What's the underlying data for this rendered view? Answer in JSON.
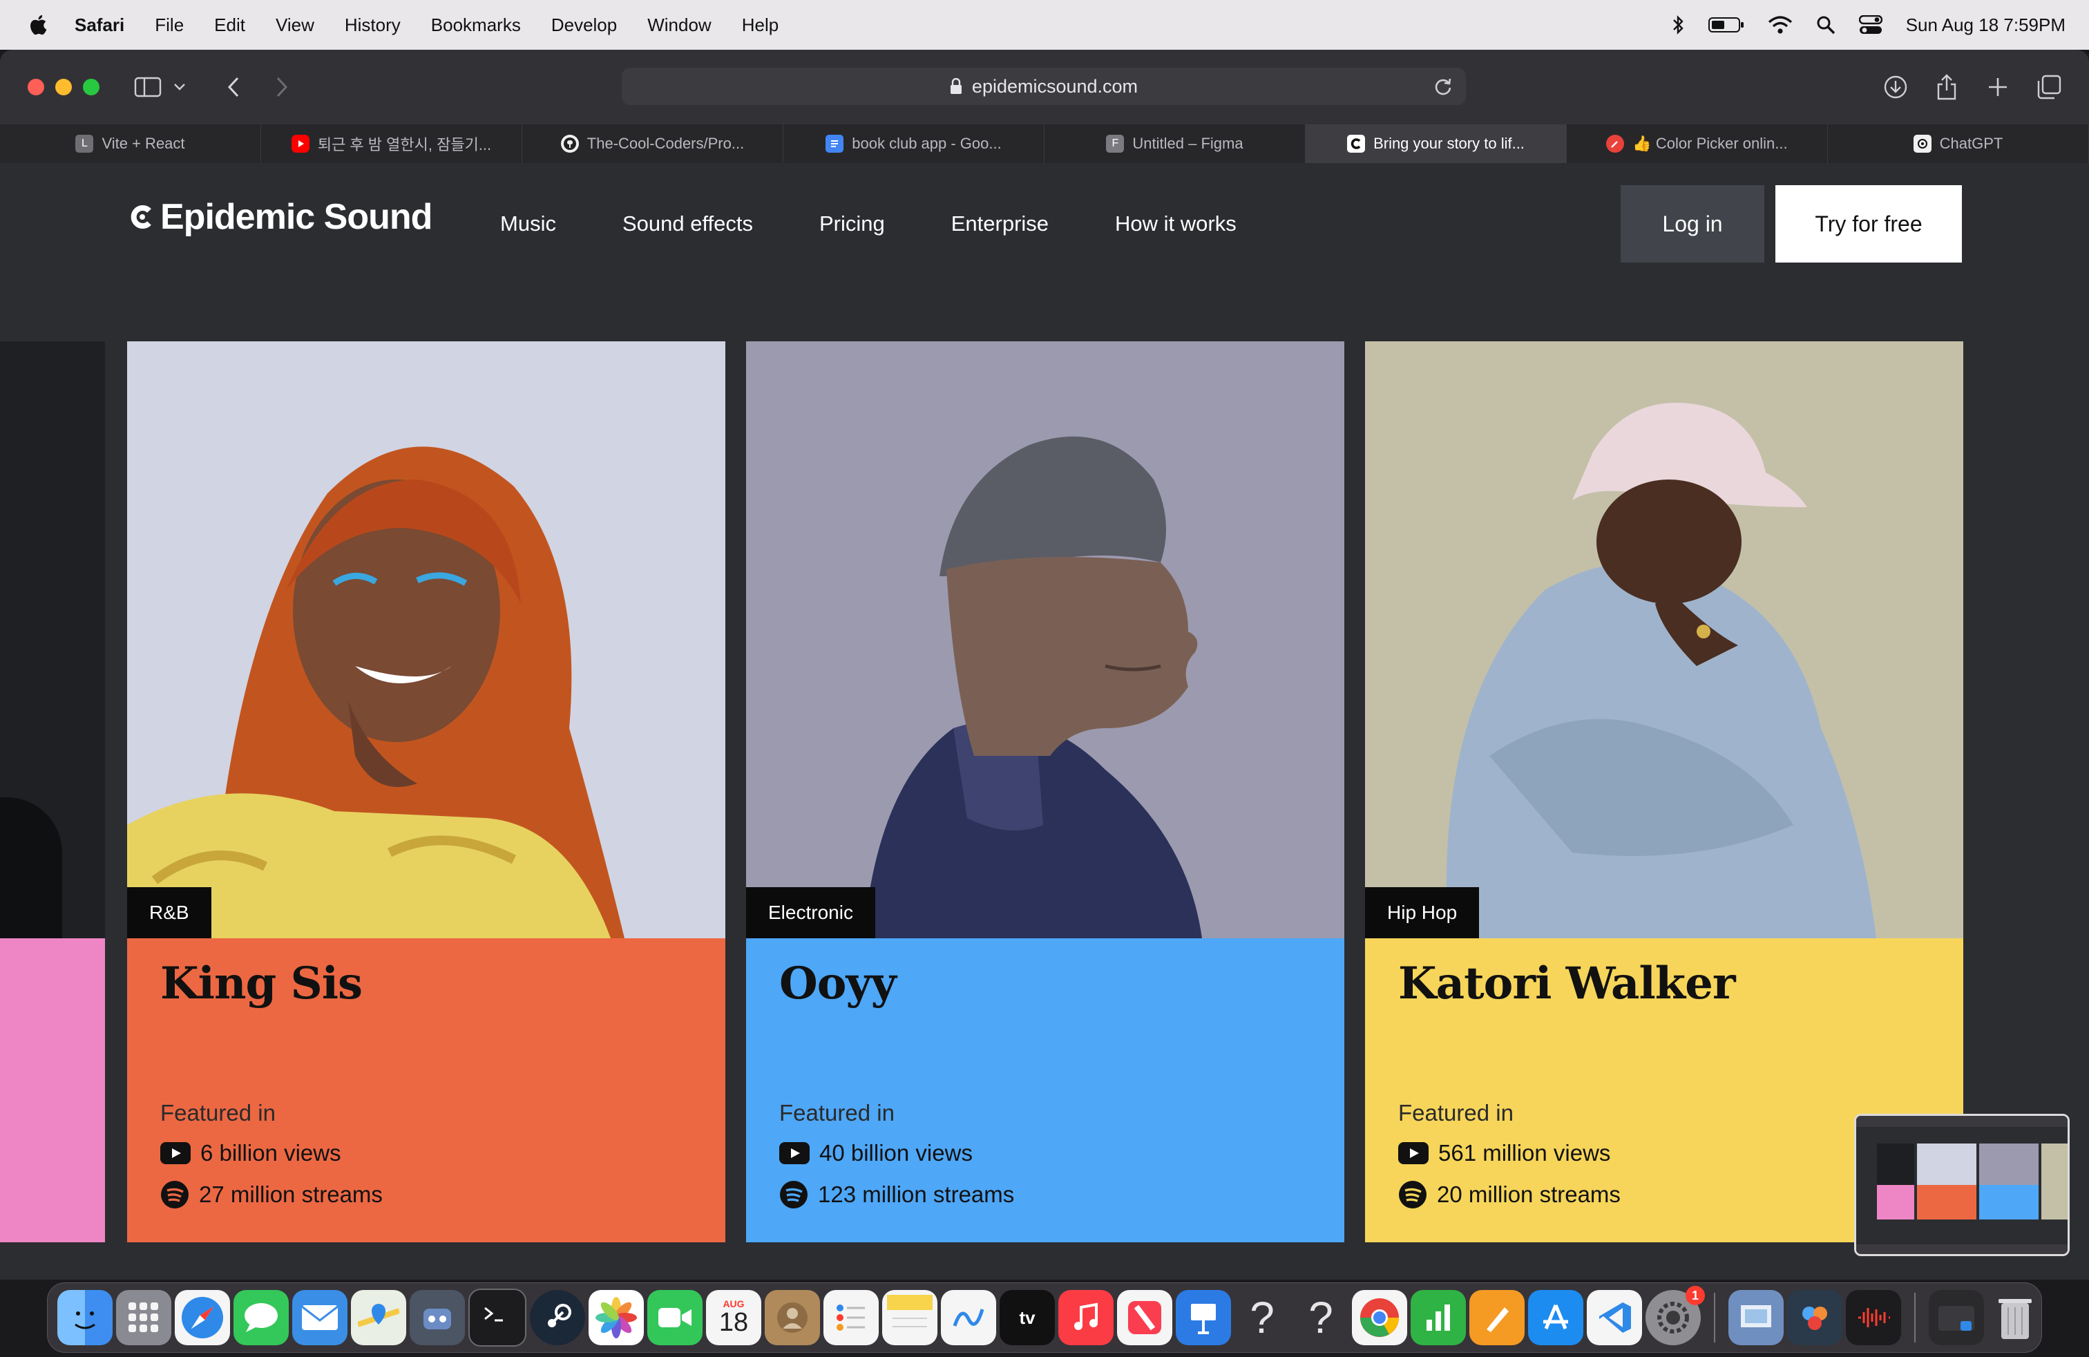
{
  "menubar": {
    "app_name": "Safari",
    "items": [
      "File",
      "Edit",
      "View",
      "History",
      "Bookmarks",
      "Develop",
      "Window",
      "Help"
    ],
    "clock": "Sun Aug 18  7:59PM"
  },
  "browser": {
    "url": "epidemicsound.com",
    "tabs": [
      {
        "label": "Vite + React",
        "favicon": "L",
        "color": "#6e6e73"
      },
      {
        "label": "퇴근 후 밤 열한시, 잠들기...",
        "favicon": "youtube-icon",
        "color": "#ff0000"
      },
      {
        "label": "The-Cool-Coders/Pro...",
        "favicon": "github-icon",
        "color": "#2b2b2b"
      },
      {
        "label": "book club app - Goo...",
        "favicon": "docs-icon",
        "color": "#4285f4"
      },
      {
        "label": "Untitled – Figma",
        "favicon": "F",
        "color": "#7a7a80"
      },
      {
        "label": "Bring your story to lif...",
        "favicon": "epidemic-icon",
        "color": "#000000"
      },
      {
        "label": "👍 Color Picker onlin...",
        "favicon": "picker-icon",
        "color": "#e8423a"
      },
      {
        "label": "ChatGPT",
        "favicon": "chatgpt-icon",
        "color": "#f0f0f0"
      }
    ],
    "active_tab_index": 5
  },
  "site": {
    "logo_text": "Epidemic Sound",
    "nav": [
      "Music",
      "Sound effects",
      "Pricing",
      "Enterprise",
      "How it works"
    ],
    "login_label": "Log in",
    "try_label": "Try for free",
    "partial_card_color": "#ee86c5",
    "artists": [
      {
        "genre": "R&B",
        "name": "King Sis",
        "featured_label": "Featured in",
        "views": "6 billion views",
        "streams": "27 million streams",
        "color": "#ec6843",
        "photo_bg": "#d1d4e2"
      },
      {
        "genre": "Electronic",
        "name": "Ooyy",
        "featured_label": "Featured in",
        "views": "40 billion views",
        "streams": "123 million streams",
        "color": "#4ea7f7",
        "photo_bg": "#9c9aaf"
      },
      {
        "genre": "Hip Hop",
        "name": "Katori Walker",
        "featured_label": "Featured in",
        "views": "561 million views",
        "streams": "20 million streams",
        "color": "#f6d55a",
        "photo_bg": "#c4c0a8"
      }
    ]
  },
  "dock": {
    "apps": [
      {
        "name": "finder-icon",
        "color": "#3d8ef0"
      },
      {
        "name": "launchpad-icon",
        "color": "#8a8a93"
      },
      {
        "name": "safari-icon",
        "color": "#2f89e8"
      },
      {
        "name": "messages-icon",
        "color": "#34c759"
      },
      {
        "name": "mail-icon",
        "color": "#3a8ee6"
      },
      {
        "name": "maps-icon",
        "color": "#5fb85a"
      },
      {
        "name": "discord-bot-icon",
        "color": "#4b5563"
      },
      {
        "name": "terminal-icon",
        "color": "#1c1c1e"
      },
      {
        "name": "steam-icon",
        "color": "#1b2838"
      },
      {
        "name": "photos-icon",
        "color": "#f0c040"
      },
      {
        "name": "facetime-icon",
        "color": "#33c75a"
      },
      {
        "name": "calendar-icon",
        "color": "#f5f5f5"
      },
      {
        "name": "contacts-icon",
        "color": "#b08a5a"
      },
      {
        "name": "reminders-icon",
        "color": "#f5f5f5"
      },
      {
        "name": "notes-icon",
        "color": "#f7d44c"
      },
      {
        "name": "freeform-icon",
        "color": "#f5f5f5"
      },
      {
        "name": "appletv-icon",
        "color": "#111111"
      },
      {
        "name": "music-icon",
        "color": "#fc3c44"
      },
      {
        "name": "news-icon",
        "color": "#f5f5f5"
      },
      {
        "name": "keynote-icon",
        "color": "#2c7be5"
      },
      {
        "name": "unknown-app-icon",
        "color": "transparent"
      },
      {
        "name": "unknown-app-icon-2",
        "color": "transparent"
      },
      {
        "name": "chrome-icon",
        "color": "#f5f5f5"
      },
      {
        "name": "numbers-icon",
        "color": "#2fb344"
      },
      {
        "name": "pages-icon",
        "color": "#f59a23"
      },
      {
        "name": "appstore-icon",
        "color": "#1d8cf0"
      },
      {
        "name": "vscode-icon",
        "color": "#f5f5f5"
      },
      {
        "name": "system-settings-icon",
        "color": "#8e8e93"
      }
    ],
    "calendar_month": "AUG",
    "calendar_day": "18",
    "settings_badge": "1",
    "unknown_glyph": "?",
    "appletv_label": "tv",
    "recent_apps": [
      {
        "name": "preview-icon",
        "color": "#6f8fc0"
      },
      {
        "name": "davinci-icon",
        "color": "#2b3a4a"
      },
      {
        "name": "voice-memos-icon",
        "color": "#1c1c1e"
      }
    ]
  }
}
